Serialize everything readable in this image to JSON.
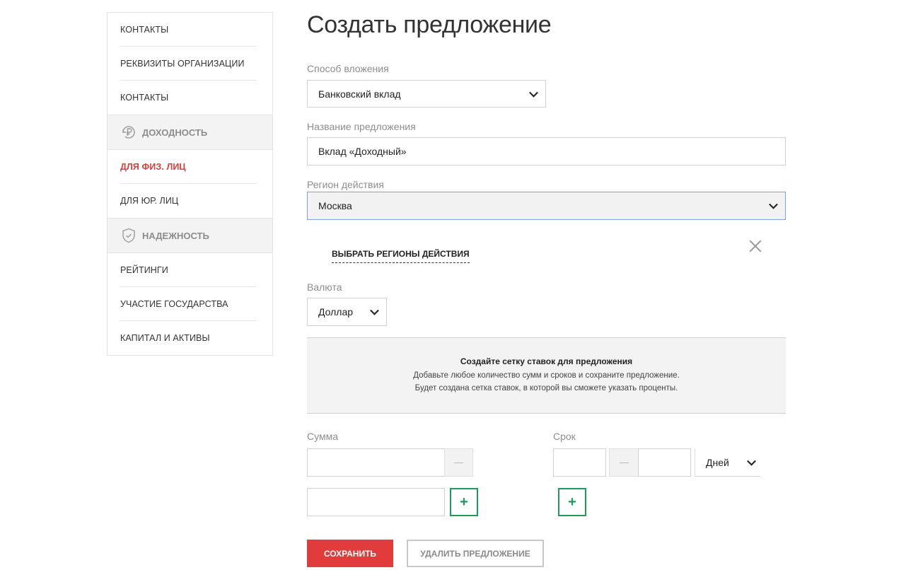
{
  "sidebar": {
    "group1": [
      "КОНТАКТЫ",
      "РЕКВИЗИТЫ ОРГАНИЗАЦИИ",
      "КОНТАКТЫ"
    ],
    "section_income": {
      "label": "ДОХОДНОСТЬ",
      "icon": "ruble-refresh-icon"
    },
    "group2": [
      "ДЛЯ ФИЗ. ЛИЦ",
      "ДЛЯ ЮР. ЛИЦ"
    ],
    "active_item": "ДЛЯ ФИЗ. ЛИЦ",
    "section_reliability": {
      "label": "НАДЕЖНОСТЬ",
      "icon": "shield-check-icon"
    },
    "group3": [
      "РЕЙТИНГИ",
      "УЧАСТИЕ ГОСУДАРСТВА",
      "КАПИТАЛ И АКТИВЫ"
    ]
  },
  "main": {
    "title": "Создать предложение",
    "investment_method": {
      "label": "Способ вложения",
      "value": "Банковский вклад"
    },
    "offer_name": {
      "label": "Название предложения",
      "value": "Вклад «Доходный»"
    },
    "region": {
      "label": "Регион действия",
      "value": "Москва"
    },
    "choose_regions_link": "ВЫБРАТЬ РЕГИОНЫ ДЕЙСТВИЯ",
    "currency": {
      "label": "Валюта",
      "value": "Доллар"
    },
    "info": {
      "title": "Создайте сетку ставок для предложения",
      "line1": "Добавьте любое количество сумм и сроков и сохраните предложение.",
      "line2": "Будет создана сетка ставок, в которой вы сможете указать проценты."
    },
    "amount": {
      "label": "Сумма",
      "add": "+"
    },
    "term": {
      "label": "Срок",
      "unit": "Дней",
      "add": "+"
    },
    "save_label": "СОХРАНИТЬ",
    "delete_label": "УДАЛИТЬ ПРЕДЛОЖЕНИЕ"
  },
  "colors": {
    "accent_red": "#e23b3b",
    "accent_green": "#1f9a5a",
    "focus_blue": "#7ea4d8"
  }
}
